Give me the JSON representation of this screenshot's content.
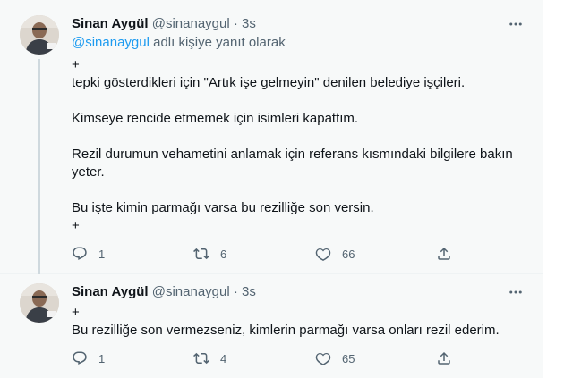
{
  "tweets": [
    {
      "author_name": "Sinan Aygül",
      "author_handle": "@sinanaygul",
      "separator": "·",
      "time": "3s",
      "reply_to_mention": "@sinanaygul",
      "reply_to_suffix": " adlı kişiye yanıt olarak",
      "lines": [
        "+",
        "tepki gösterdikleri için \"Artık işe gelmeyin\" denilen belediye işçileri.",
        "",
        "Kimseye rencide etmemek için isimleri kapattım.",
        "",
        "Rezil durumun vehametini anlamak için referans kısmındaki bilgilere bakın yeter.",
        "",
        "Bu işte kimin parmağı varsa bu rezilliğe son versin.",
        "+"
      ],
      "reply_count": "1",
      "retweet_count": "6",
      "like_count": "66"
    },
    {
      "author_name": "Sinan Aygül",
      "author_handle": "@sinanaygul",
      "separator": "·",
      "time": "3s",
      "lines": [
        "+",
        "Bu rezilliğe son vermezseniz, kimlerin parmağı varsa onları rezil ederim."
      ],
      "reply_count": "1",
      "retweet_count": "4",
      "like_count": "65"
    }
  ],
  "icons": {
    "more": "more-horizontal-icon",
    "reply": "reply-icon",
    "retweet": "retweet-icon",
    "like": "heart-icon",
    "share": "share-icon"
  },
  "colors": {
    "accent": "#1d9bf0",
    "secondary_text": "#536471",
    "background": "#f7f9f9"
  }
}
